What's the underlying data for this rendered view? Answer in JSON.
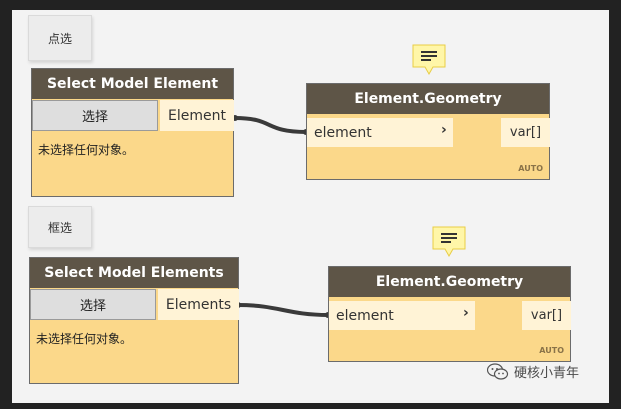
{
  "groups": [
    {
      "label": "点选"
    },
    {
      "label": "框选"
    }
  ],
  "nodes": {
    "select_one": {
      "title": "Select Model Element",
      "button": "选择",
      "output": "Element",
      "status": "未选择任何对象。"
    },
    "geometry_one": {
      "title": "Element.Geometry",
      "input": "element",
      "output": "var[]",
      "lacing": "AUTO"
    },
    "select_many": {
      "title": "Select Model Elements",
      "button": "选择",
      "output": "Elements",
      "status": "未选择任何对象。"
    },
    "geometry_two": {
      "title": "Element.Geometry",
      "input": "element",
      "output": "var[]",
      "lacing": "AUTO"
    }
  },
  "icons": {
    "note": "note-icon",
    "chevron": "chevron-right-icon",
    "watermark": "wechat-icon"
  },
  "colors": {
    "node_body": "#fbd88a",
    "node_header": "#5e5547",
    "port": "#fff3d6",
    "wire": "#3a3a3a",
    "note": "#fff6a8"
  },
  "watermark": {
    "text": "硬核小青年"
  }
}
